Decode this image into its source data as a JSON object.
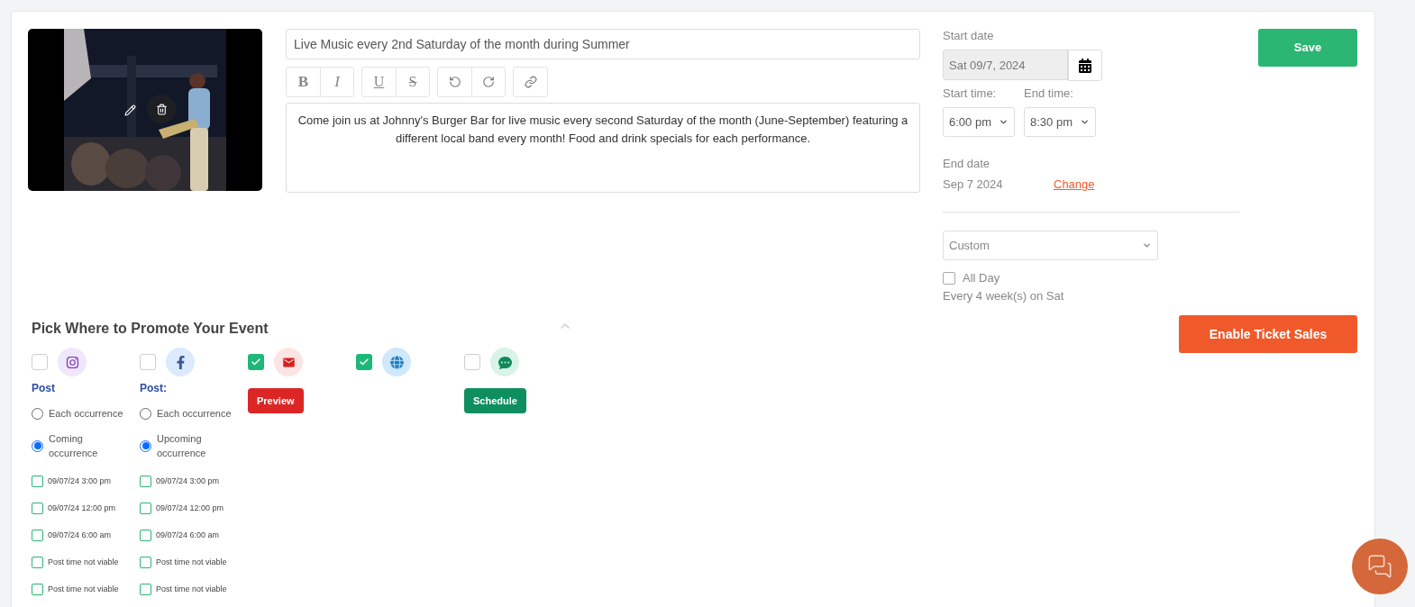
{
  "event": {
    "title": "Live Music every 2nd Saturday of the month during Summer",
    "toolbar": [
      {
        "kind": "bold",
        "glyph": "B"
      },
      {
        "kind": "italic",
        "glyph": "I"
      },
      {
        "kind": "underline",
        "glyph": "U"
      },
      {
        "kind": "strikethrough",
        "glyph": "S"
      },
      {
        "kind": "undo"
      },
      {
        "kind": "redo"
      },
      {
        "kind": "link"
      }
    ],
    "description": "Come join us at Johnny's Burger Bar for live music every second Saturday of the month (June-September) featuring a different local band every month! Food and drink specials for each performance."
  },
  "schedule": {
    "start_date_label": "Start date",
    "start_date": "Sat 09/7, 2024",
    "start_time_label": "Start time:",
    "start_time": "6:00 pm",
    "end_time_label": "End time:",
    "end_time": "8:30 pm",
    "end_date_label": "End date",
    "end_date": "Sep 7 2024",
    "change_link": "Change",
    "repeat": "Custom",
    "all_day_label": "All Day",
    "all_day": false,
    "summary": "Every 4 week(s) on Sat"
  },
  "save_button": "Save",
  "ticket_button": "Enable Ticket Sales",
  "promote": {
    "title": "Pick Where to Promote Your Event",
    "expanded": true,
    "channels": [
      {
        "kind": "instagram",
        "checked": false,
        "post_label": "Post",
        "options": [
          {
            "label": "Each occurrence",
            "selected": false
          },
          {
            "label": "Coming occurrence",
            "selected": true
          }
        ],
        "times": [
          {
            "label": "09/07/24 3:00 pm",
            "checked": false
          },
          {
            "label": "09/07/24 12:00 pm",
            "checked": false
          },
          {
            "label": "09/07/24 6:00 am",
            "checked": false
          },
          {
            "label": "Post time not viable",
            "checked": false
          },
          {
            "label": "Post time not viable",
            "checked": false
          }
        ]
      },
      {
        "kind": "facebook",
        "checked": false,
        "post_label": "Post:",
        "options": [
          {
            "label": "Each occurrence",
            "selected": false
          },
          {
            "label": "Upcoming occurrence",
            "selected": true
          }
        ],
        "times": [
          {
            "label": "09/07/24 3:00 pm",
            "checked": false
          },
          {
            "label": "09/07/24 12:00 pm",
            "checked": false
          },
          {
            "label": "09/07/24 6:00 am",
            "checked": false
          },
          {
            "label": "Post time not viable",
            "checked": false
          },
          {
            "label": "Post time not viable",
            "checked": false
          }
        ]
      },
      {
        "kind": "email",
        "checked": true,
        "button": "Preview"
      },
      {
        "kind": "web",
        "checked": true
      },
      {
        "kind": "sms",
        "checked": false,
        "button": "Schedule"
      }
    ]
  }
}
